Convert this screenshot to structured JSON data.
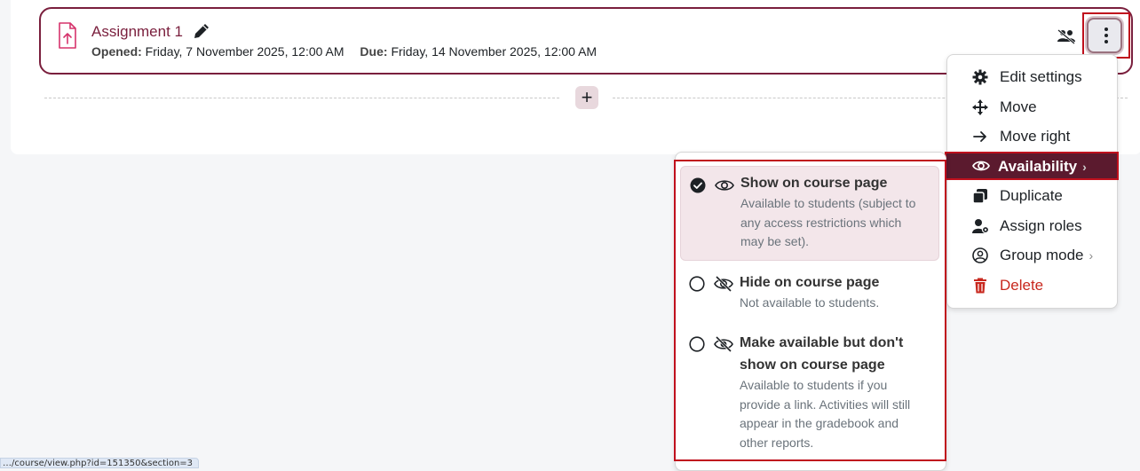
{
  "activity": {
    "title": "Assignment 1",
    "opened_label": "Opened:",
    "opened_value": "Friday, 7 November 2025, 12:00 AM",
    "due_label": "Due:",
    "due_value": "Friday, 14 November 2025, 12:00 AM"
  },
  "action_menu": {
    "items": [
      {
        "label": "Edit settings",
        "icon": "gear-icon"
      },
      {
        "label": "Move",
        "icon": "move-arrows-icon"
      },
      {
        "label": "Move right",
        "icon": "arrow-right-icon"
      },
      {
        "label": "Availability",
        "icon": "eye-icon",
        "chevron": "›"
      },
      {
        "label": "Duplicate",
        "icon": "copy-icon"
      },
      {
        "label": "Assign roles",
        "icon": "user-gear-icon"
      },
      {
        "label": "Group mode",
        "icon": "user-circle-icon",
        "chevron": "›"
      },
      {
        "label": "Delete",
        "icon": "trash-icon"
      }
    ]
  },
  "availability": {
    "options": [
      {
        "title": "Show on course page",
        "desc_lines": [
          "Available to students (subject to",
          "any access restrictions which",
          "may be set)."
        ],
        "selected": true
      },
      {
        "title": "Hide on course page",
        "desc_lines": [
          "Not available to students."
        ],
        "selected": false
      },
      {
        "title_lines": [
          "Make available but don't",
          "show on course page"
        ],
        "desc_lines": [
          "Available to students if you",
          "provide a link. Activities will still",
          "appear in the gradebook and",
          "other reports."
        ],
        "selected": false
      }
    ]
  },
  "add_button": "+",
  "status_url": "…/course/view.php?id=151350&section=3",
  "colors": {
    "brand": "#7a1f3d",
    "active_bg": "#5b1a2e",
    "danger": "#c8281e",
    "highlight": "#c0101d"
  }
}
